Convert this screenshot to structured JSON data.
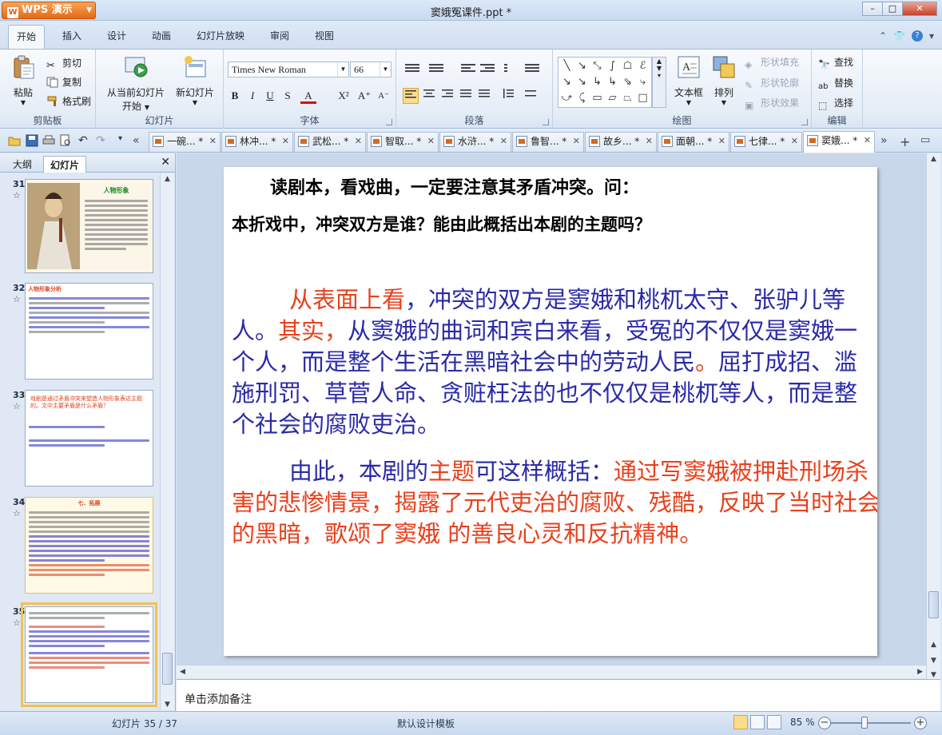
{
  "app": {
    "button_label": "WPS 演示",
    "window_title": "窦娥冤课件.ppt *"
  },
  "menu": {
    "tabs": [
      "开始",
      "插入",
      "设计",
      "动画",
      "幻灯片放映",
      "审阅",
      "视图"
    ],
    "active": "开始"
  },
  "ribbon": {
    "clipboard": {
      "paste": "粘贴",
      "cut": "剪切",
      "copy": "复制",
      "format_painter": "格式刷",
      "label": "剪贴板"
    },
    "slides": {
      "from_current_line1": "从当前幻灯片",
      "from_current_line2": "开始",
      "new_slide": "新幻灯片",
      "label": "幻灯片"
    },
    "font": {
      "family": "Times New Roman",
      "size": "66",
      "label": "字体"
    },
    "paragraph": {
      "label": "段落"
    },
    "drawing": {
      "text_box": "文本框",
      "arrange": "排列",
      "shape_fill": "形状填充",
      "shape_outline": "形状轮廓",
      "shape_effects": "形状效果",
      "label": "绘图"
    },
    "editing": {
      "find": "查找",
      "replace": "替换",
      "select": "选择",
      "label": "编辑"
    }
  },
  "doc_tabs": [
    {
      "label": "一碗...",
      "mark": "*"
    },
    {
      "label": "林冲...",
      "mark": "*"
    },
    {
      "label": "武松...",
      "mark": "*"
    },
    {
      "label": "智取...",
      "mark": "*"
    },
    {
      "label": "水浒...",
      "mark": "*"
    },
    {
      "label": "鲁智...",
      "mark": "*"
    },
    {
      "label": "故乡...",
      "mark": "*"
    },
    {
      "label": "面朝...",
      "mark": "*"
    },
    {
      "label": "七律...",
      "mark": "*"
    },
    {
      "label": "窦娥...",
      "mark": "*"
    }
  ],
  "left_panel": {
    "tabs": [
      "大纲",
      "幻灯片"
    ],
    "active_tab": "幻灯片",
    "thumbs": [
      {
        "num": "31",
        "title": "人物形象"
      },
      {
        "num": "32",
        "title": "人物形象分析"
      },
      {
        "num": "33",
        "title": "戏剧是通过矛盾冲突来塑造人物形象表达主题的。文中主要矛盾是什么矛盾？"
      },
      {
        "num": "34",
        "title": "七、拓展"
      },
      {
        "num": "35",
        "title": ""
      }
    ]
  },
  "slide": {
    "q1": "读剧本，看戏曲，一定要注意其矛盾冲突。问：",
    "q2": "本折戏中，冲突双方是谁？能由此概括出本剧的主题吗？",
    "p1_a": "从表面上看",
    "p1_b": "，冲突的双方是窦娥和桃杌太守、张驴儿等人。",
    "p1_c": "其实，",
    "p1_d": "从窦娥的曲词和宾白来看，受冤的不仅仅是窦娥一个人，而是整个生活在黑暗社会中的劳动人民",
    "p1_e": "。",
    "p1_f": "屈打成招、滥施刑罚、草菅人命、贪赃枉法的也不仅仅是桃杌等人，而是整个社会的腐败吏治。",
    "p2_a": "由此，本剧的",
    "p2_b": "主题",
    "p2_c": "可这样概括：",
    "p2_d": "通过写窦娥被押赴刑场杀害的悲惨情景，揭露了元代吏治的腐败、残酷，反映了当时社会的黑暗，歌颂了窦娥 的善良心灵和反抗精神。"
  },
  "notes_placeholder": "单击添加备注",
  "status": {
    "slide_count": "幻灯片 35 / 37",
    "theme": "默认设计模板",
    "zoom": "85 %"
  }
}
